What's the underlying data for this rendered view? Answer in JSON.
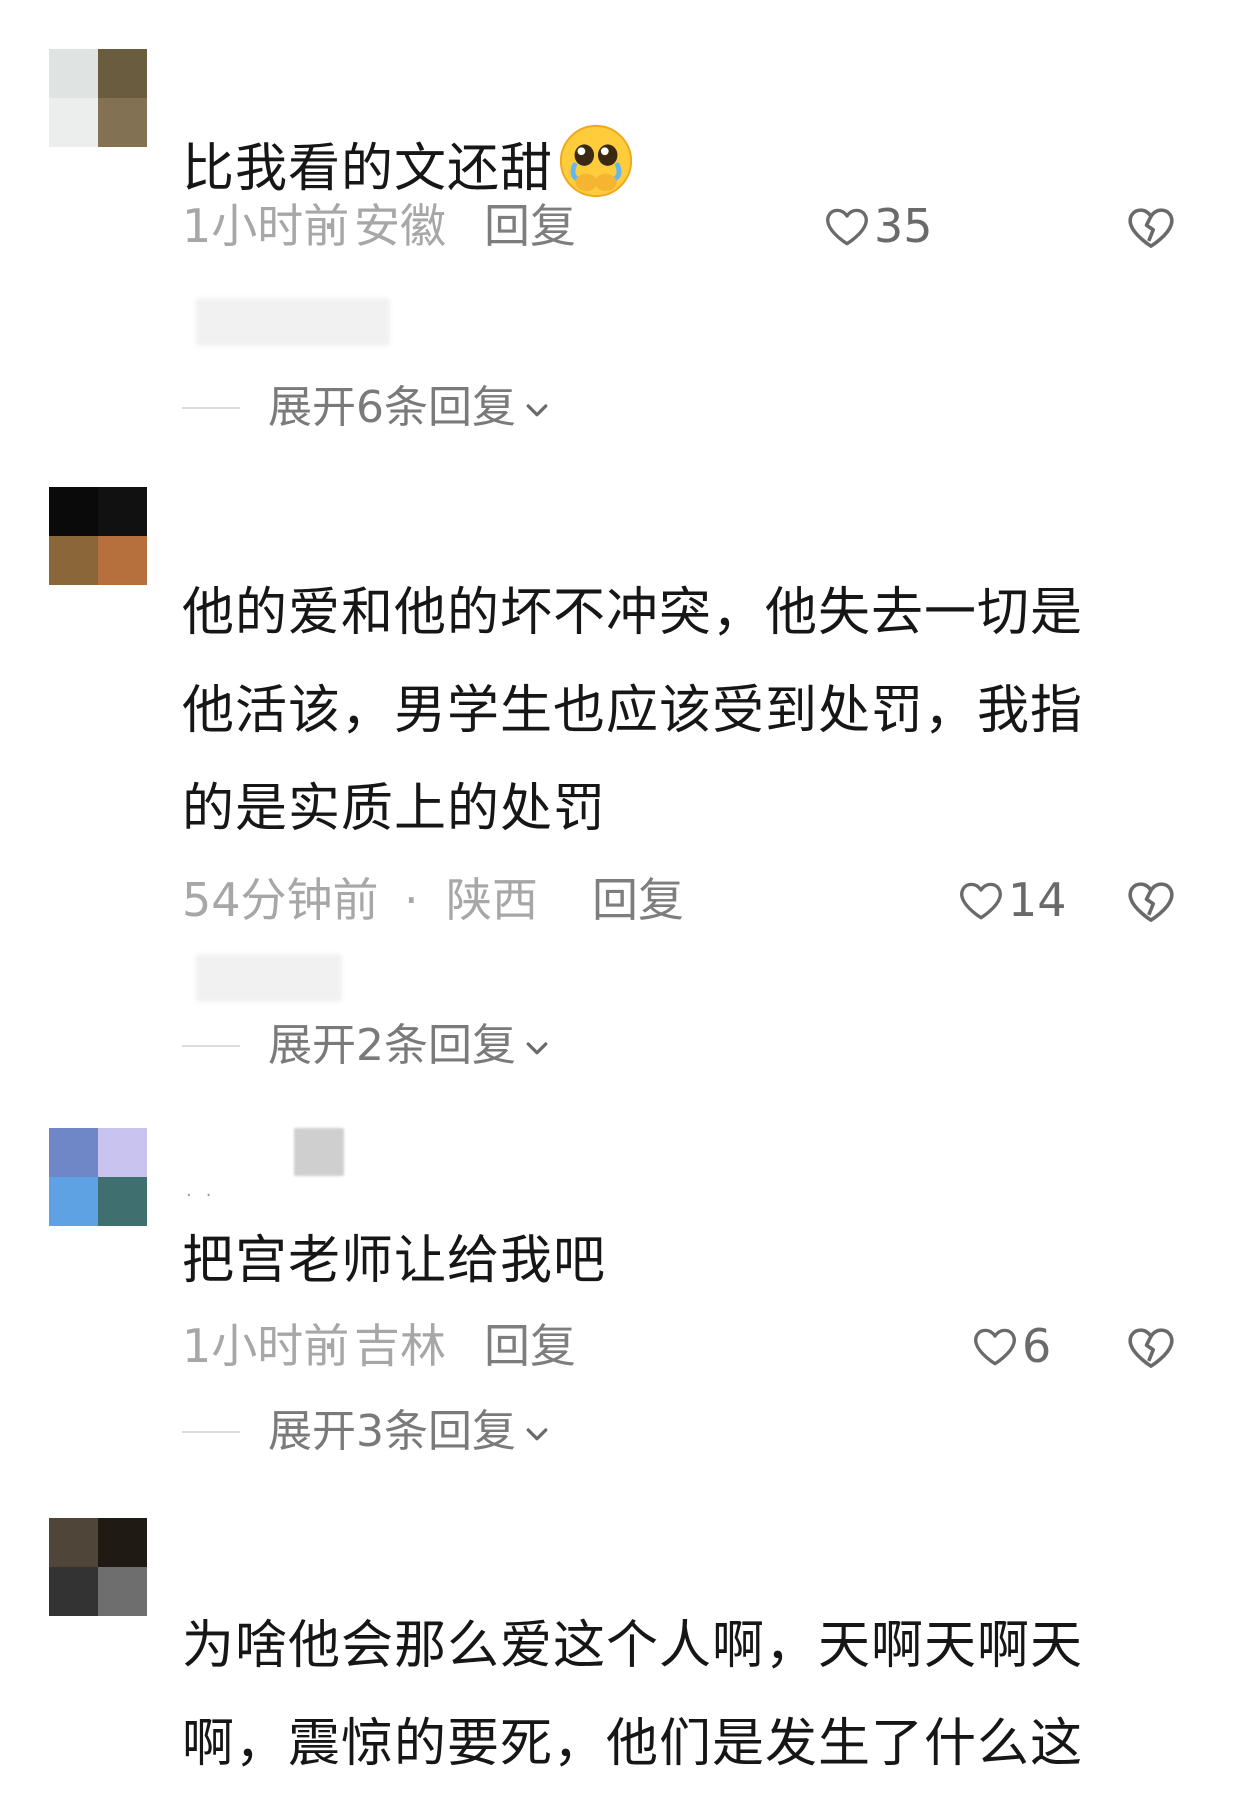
{
  "comments": [
    {
      "text": "比我看的文还甜",
      "emoji": "pleading-face-emoji",
      "time": "1小时前",
      "separator": "·",
      "region": "安徽",
      "reply_label": "回复",
      "like_count": "35",
      "expand_label": "展开6条回复",
      "avatar_colors": [
        "#dfe3e1",
        "#6a5c3f",
        "#eceeed",
        "#837154"
      ]
    },
    {
      "text_lines": [
        "他的爱和他的坏不冲突，他失去一切是",
        "他活该，男学生也应该受到处罚，我指",
        "的是实质上的处罚"
      ],
      "time": "54分钟前",
      "separator": "·",
      "region": "陕西",
      "reply_label": "回复",
      "like_count": "14",
      "expand_label": "展开2条回复",
      "avatar_colors": [
        "#0a0a0a",
        "#111111",
        "#8a6638",
        "#b5703d"
      ]
    },
    {
      "text": "把宫老师让给我吧",
      "time": "1小时前",
      "separator": "·",
      "region": "吉林",
      "reply_label": "回复",
      "like_count": "6",
      "expand_label": "展开3条回复",
      "avatar_colors": [
        "#6f87c7",
        "#c8c3ef",
        "#5ea2e3",
        "#3f6f6f"
      ]
    },
    {
      "text_lines": [
        "为啥他会那么爱这个人啊，天啊天啊天",
        "啊，震惊的要死，他们是发生了什么这"
      ],
      "avatar_colors": [
        "#4f4539",
        "#1f1a14",
        "#333333",
        "#6e6e6e"
      ]
    }
  ],
  "icons": {
    "like": "heart-outline-icon",
    "dislike": "broken-heart-icon",
    "expand": "chevron-down-icon"
  }
}
